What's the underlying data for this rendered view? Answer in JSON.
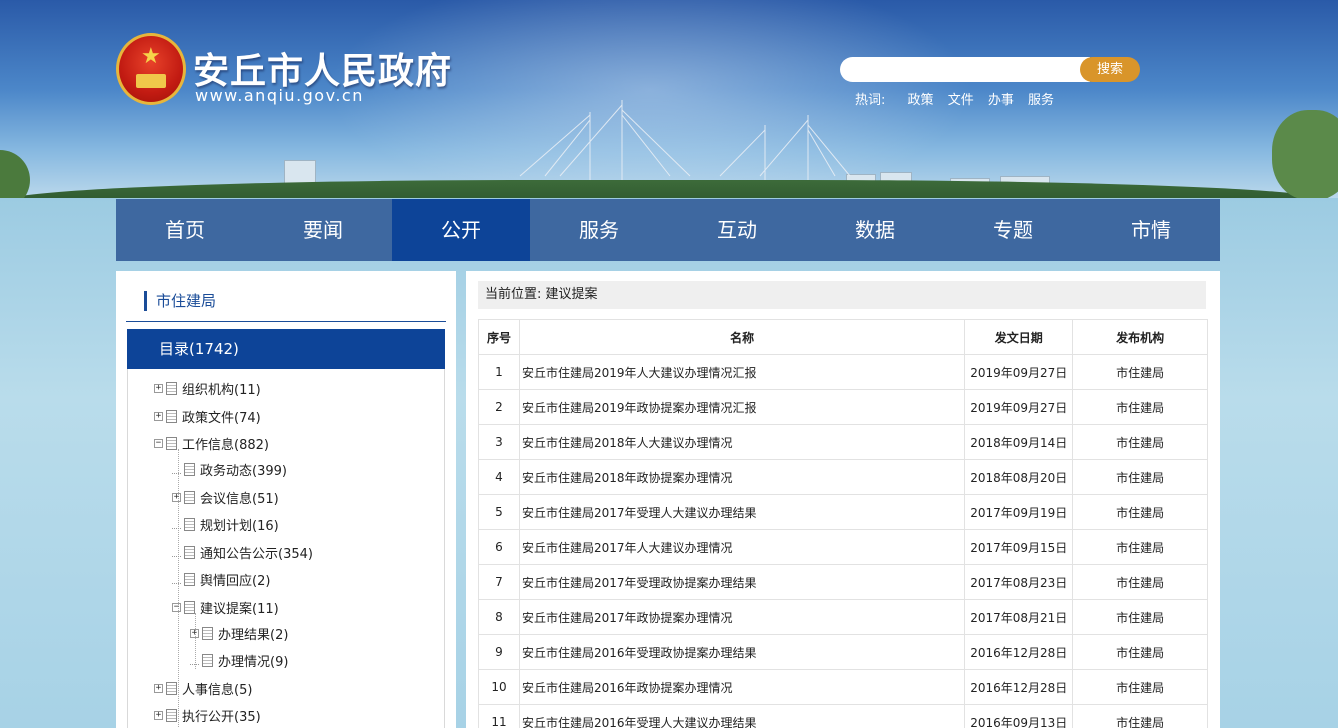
{
  "site": {
    "title": "安丘市人民政府",
    "url": "www.anqiu.gov.cn"
  },
  "search": {
    "placeholder": "",
    "button_label": "搜索",
    "hot_label": "热词:",
    "hot_words": [
      "政策",
      "文件",
      "办事",
      "服务"
    ]
  },
  "nav": {
    "items": [
      "首页",
      "要闻",
      "公开",
      "服务",
      "互动",
      "数据",
      "专题",
      "市情"
    ],
    "active": "公开"
  },
  "sidebar": {
    "department": "市住建局",
    "catalog_label": "目录(1742)",
    "tree": [
      {
        "label": "组织机构(11)",
        "toggle": "+"
      },
      {
        "label": "政策文件(74)",
        "toggle": "+"
      },
      {
        "label": "工作信息(882)",
        "toggle": "-"
      },
      {
        "label": "政务动态(399)",
        "toggle": ""
      },
      {
        "label": "会议信息(51)",
        "toggle": "+"
      },
      {
        "label": "规划计划(16)",
        "toggle": ""
      },
      {
        "label": "通知公告公示(354)",
        "toggle": ""
      },
      {
        "label": "舆情回应(2)",
        "toggle": ""
      },
      {
        "label": "建议提案(11)",
        "toggle": "-"
      },
      {
        "label": "办理结果(2)",
        "toggle": "+"
      },
      {
        "label": "办理情况(9)",
        "toggle": ""
      },
      {
        "label": "人事信息(5)",
        "toggle": "+"
      },
      {
        "label": "执行公开(35)",
        "toggle": "+"
      }
    ]
  },
  "main": {
    "breadcrumb": "当前位置: 建议提案",
    "columns": [
      "序号",
      "名称",
      "发文日期",
      "发布机构"
    ],
    "rows": [
      [
        "1",
        "安丘市住建局2019年人大建议办理情况汇报",
        "2019年09月27日",
        "市住建局"
      ],
      [
        "2",
        "安丘市住建局2019年政协提案办理情况汇报",
        "2019年09月27日",
        "市住建局"
      ],
      [
        "3",
        "安丘市住建局2018年人大建议办理情况",
        "2018年09月14日",
        "市住建局"
      ],
      [
        "4",
        "安丘市住建局2018年政协提案办理情况",
        "2018年08月20日",
        "市住建局"
      ],
      [
        "5",
        "安丘市住建局2017年受理人大建议办理结果",
        "2017年09月19日",
        "市住建局"
      ],
      [
        "6",
        "安丘市住建局2017年人大建议办理情况",
        "2017年09月15日",
        "市住建局"
      ],
      [
        "7",
        "安丘市住建局2017年受理政协提案办理结果",
        "2017年08月23日",
        "市住建局"
      ],
      [
        "8",
        "安丘市住建局2017年政协提案办理情况",
        "2017年08月21日",
        "市住建局"
      ],
      [
        "9",
        "安丘市住建局2016年受理政协提案办理结果",
        "2016年12月28日",
        "市住建局"
      ],
      [
        "10",
        "安丘市住建局2016年政协提案办理情况",
        "2016年12月28日",
        "市住建局"
      ],
      [
        "11",
        "安丘市住建局2016年受理人大建议办理结果",
        "2016年09月13日",
        "市住建局"
      ]
    ]
  },
  "colors": {
    "nav_bg": "#3e68a0",
    "nav_active": "#0d4498",
    "search_button": "#d9952a",
    "accent": "#1a4c98"
  }
}
